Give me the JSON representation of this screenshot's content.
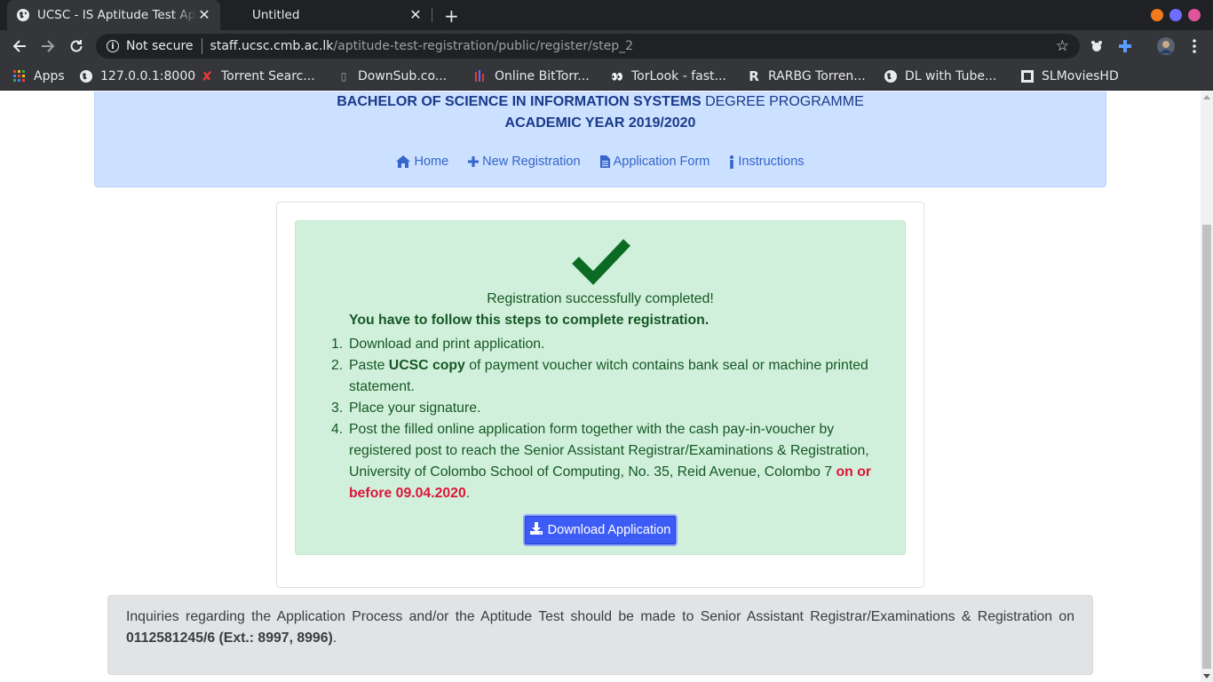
{
  "browser": {
    "tabs": [
      {
        "title": "UCSC - IS Aptitude Test Ap",
        "active": true
      },
      {
        "title": "Untitled",
        "active": false
      }
    ],
    "omnibox": {
      "security": "Not secure",
      "host": "staff.ucsc.cmb.ac.lk",
      "path": "/aptitude-test-registration/public/register/step_2"
    },
    "window_dot_colors": [
      "#f07b1e",
      "#6d6dff",
      "#e0549b"
    ],
    "bookmarks": [
      {
        "label": "Apps",
        "icon": "apps-grid-icon"
      },
      {
        "label": "127.0.0.1:8000",
        "icon": "globe-icon"
      },
      {
        "label": "Torrent Searc...",
        "icon": "x-icon"
      },
      {
        "label": "DownSub.co...",
        "icon": "downsub-icon"
      },
      {
        "label": "Online BitTorr...",
        "icon": "bittorrent-icon"
      },
      {
        "label": "TorLook - fast...",
        "icon": "eyes-icon"
      },
      {
        "label": "RARBG Torren...",
        "icon": "rarbg-icon"
      },
      {
        "label": "DL with Tube...",
        "icon": "globe-icon"
      },
      {
        "label": "SLMoviesHD",
        "icon": "film-icon"
      }
    ]
  },
  "header": {
    "line1_bold": "BACHELOR OF SCIENCE IN INFORMATION SYSTEMS",
    "line1_rest": " DEGREE PROGRAMME",
    "line2": "ACADEMIC YEAR 2019/2020",
    "nav": {
      "home": "Home",
      "new_registration": "New Registration",
      "application_form": "Application Form",
      "instructions": "Instructions"
    }
  },
  "alert": {
    "success": "Registration successfully completed!",
    "steps_title": "You have to follow this steps to complete registration.",
    "step1": "Download and print application.",
    "step2_a": "Paste ",
    "step2_b": "UCSC copy",
    "step2_c": " of payment voucher witch contains bank seal or machine printed statement.",
    "step3": "Place your signature.",
    "step4_a": "Post the filled online application form together with the cash pay-in-voucher by registered post to reach the Senior Assistant Registrar/Examinations & Registration, University of Colombo School of Computing, No. 35, Reid Avenue, Colombo 7 ",
    "step4_b": "on or before 09.04.2020",
    "step4_c": ".",
    "button": "Download Application"
  },
  "footer": {
    "text": "Inquiries regarding the Application Process and/or the Aptitude Test should be made to Senior Assistant Registrar/Examinations & Registration on ",
    "phone": "0112581245/6 (Ext.: 8997, 8996)",
    "end": "."
  }
}
